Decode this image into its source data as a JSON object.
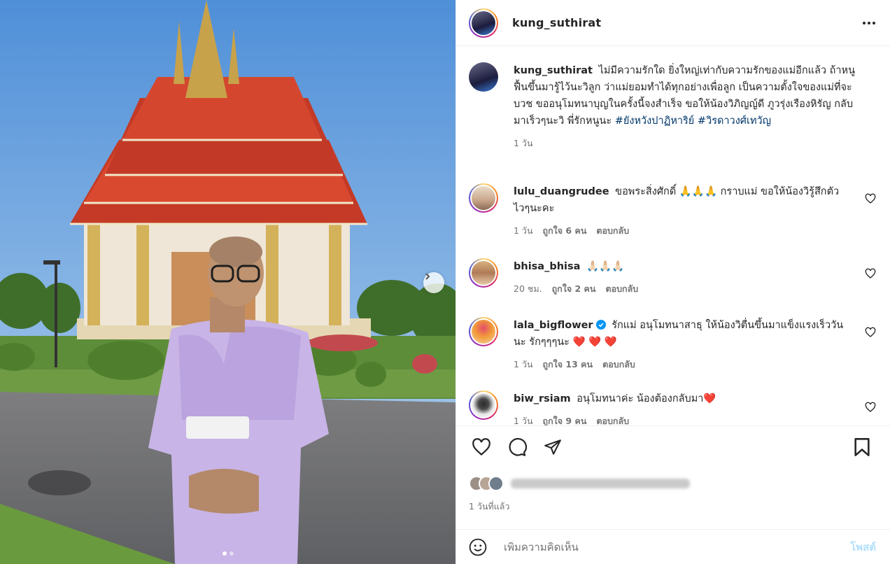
{
  "header": {
    "username": "kung_suthirat",
    "more_icon": "more-horizontal-icon"
  },
  "caption": {
    "username": "kung_suthirat",
    "text": "ไม่มีความรักใด ยิ่งใหญ่เท่ากับความรักของแม่อีกแล้ว ถ้าหนูฟื้นขึ้นมารู้ไว้นะวิลูก ว่าแม่ยอมทำได้ทุกอย่างเพื่อลูก เป็นความตั้งใจของแม่ที่จะบวช ขออนุโมทนาบุญในครั้งนี้จงสำเร็จ ขอให้น้องวิภิญญ์ดี ภูวรุ่งเรืองหิรัญ กลับมาเร็วๆนะวิ พี่รักหนูนะ",
    "hashtag_1": "#ยังหวังปาฏิหาริย์",
    "hashtag_2": "#วิรดาวงศ์เทวัญ",
    "time": "1 วัน"
  },
  "comments": [
    {
      "username": "lulu_duangrudee",
      "text": "ขอพระสิ่งศักดิ์ 🙏🙏🙏 กราบแม่ ขอให้น้องวิรู้สึกตัวไวๆนะคะ",
      "time": "1 วัน",
      "likes": "ถูกใจ 6 คน",
      "reply": "ตอบกลับ"
    },
    {
      "username": "bhisa_bhisa",
      "text": "🙏🏻🙏🏻🙏🏻",
      "time": "20 ชม.",
      "likes": "ถูกใจ 2 คน",
      "reply": "ตอบกลับ"
    },
    {
      "username": "lala_bigflower",
      "text": "รักแม่ อนุโมทนาสาธุ ให้น้องวิตื่นขึ้นมาแข็งแรงเร็ววันนะ รักๆๆๆนะ ❤️ ❤️ ❤️",
      "time": "1 วัน",
      "likes": "ถูกใจ 13 คน",
      "reply": "ตอบกลับ"
    },
    {
      "username": "biw_rsiam",
      "text": "อนุโมทนาค่ะ น้องต้องกลับมา❤️",
      "time": "1 วัน",
      "likes": "ถูกใจ 9 คน",
      "reply": "ตอบกลับ"
    }
  ],
  "post_time": "1 วันที่แล้ว",
  "composer": {
    "placeholder": "เพิ่มความคิดเห็น",
    "post_label": "โพสต์"
  },
  "carousel": {
    "slide_count": 2,
    "active_slide": 1
  },
  "colors": {
    "link": "#00376b",
    "meta": "#737373",
    "post_button_disabled": "#b2dffc",
    "verified": "#0095f6"
  }
}
